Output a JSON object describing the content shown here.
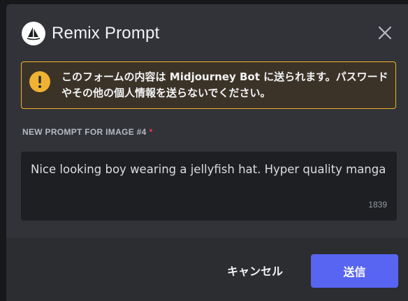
{
  "modal": {
    "title": "Remix Prompt",
    "close_icon": "close-icon",
    "logo_icon": "midjourney-sailboat-icon"
  },
  "warning": {
    "icon": "exclamation-icon",
    "text": "このフォームの内容は Midjourney Bot に送られます。パスワードやその他の個人情報を送らないでください。",
    "color": "#f0b232"
  },
  "field": {
    "label": "NEW PROMPT FOR IMAGE #4",
    "required_mark": "*",
    "value": "Nice looking boy wearing a jellyfish hat. Hyper quality manga",
    "char_count": "1839"
  },
  "footer": {
    "cancel_label": "キャンセル",
    "submit_label": "送信",
    "accent": "#5865f2"
  }
}
